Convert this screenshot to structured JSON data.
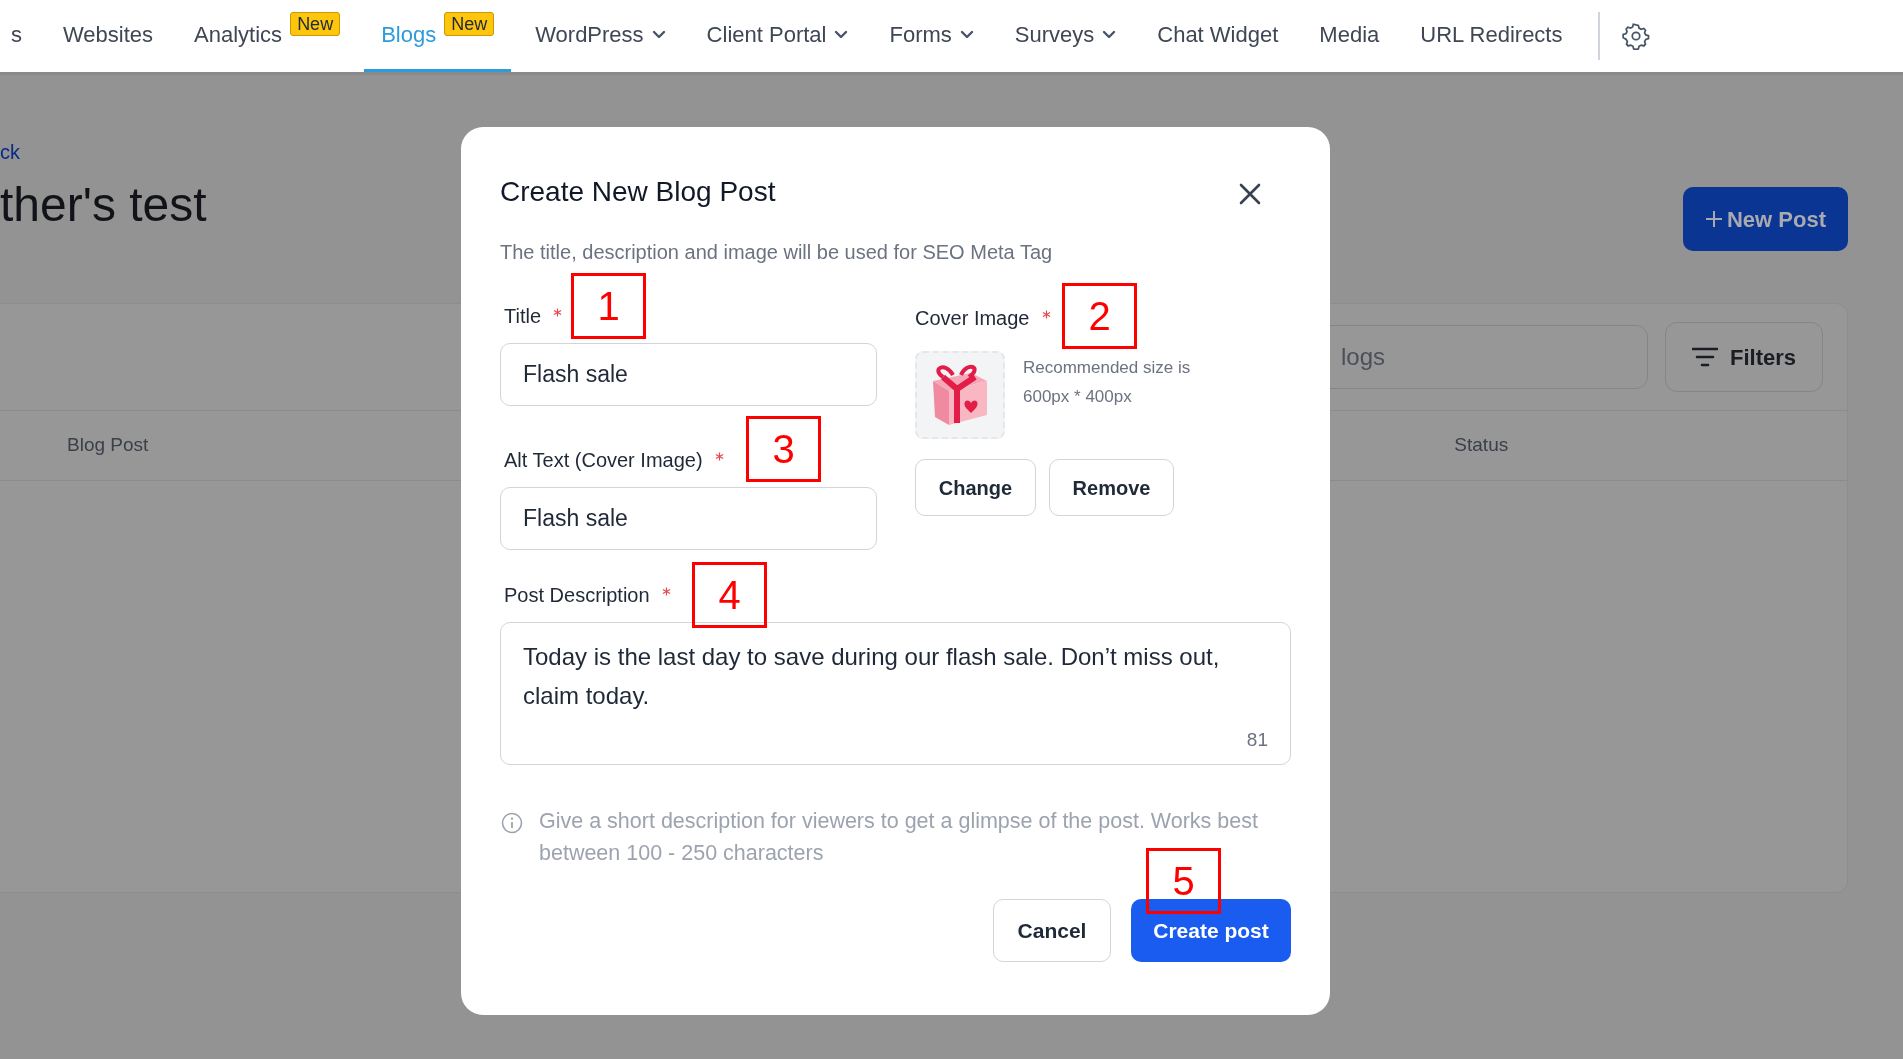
{
  "nav": {
    "items": [
      {
        "label": "s",
        "selected": false,
        "dropdown": false
      },
      {
        "label": "Websites",
        "selected": false,
        "dropdown": false
      },
      {
        "label": "Analytics",
        "selected": false,
        "dropdown": false,
        "badge": "New"
      },
      {
        "label": "Blogs",
        "selected": true,
        "dropdown": false,
        "badge": "New"
      },
      {
        "label": "WordPress",
        "selected": false,
        "dropdown": true
      },
      {
        "label": "Client Portal",
        "selected": false,
        "dropdown": true
      },
      {
        "label": "Forms",
        "selected": false,
        "dropdown": true
      },
      {
        "label": "Surveys",
        "selected": false,
        "dropdown": true
      },
      {
        "label": "Chat Widget",
        "selected": false,
        "dropdown": false
      },
      {
        "label": "Media",
        "selected": false,
        "dropdown": false
      },
      {
        "label": "URL Redirects",
        "selected": false,
        "dropdown": false
      }
    ]
  },
  "page": {
    "back_link": "ck",
    "heading": "ther's test",
    "new_post_button": "New Post",
    "search": {
      "placeholder": "logs"
    },
    "filters_button": "Filters",
    "table": {
      "columns": [
        "Blog Post",
        "Status"
      ]
    }
  },
  "modal": {
    "title": "Create New Blog Post",
    "subtitle": "The title, description and image will be used for SEO Meta Tag",
    "title_field": {
      "label": "Title",
      "required": true,
      "value": "Flash sale"
    },
    "alt_field": {
      "label": "Alt Text (Cover Image)",
      "required": true,
      "value": "Flash sale"
    },
    "cover_image": {
      "label": "Cover Image",
      "required": true,
      "hint": "Recommended size is 600px * 400px",
      "change_button": "Change",
      "remove_button": "Remove"
    },
    "description": {
      "label": "Post Description",
      "required": true,
      "value": "Today is the last day to save during our flash sale. Don’t miss out, claim today.",
      "counter": "81"
    },
    "help": "Give a short description for viewers to get a glimpse of the post. Works best between 100 - 250 characters",
    "cancel_button": "Cancel",
    "create_button": "Create post"
  },
  "annotations": [
    "1",
    "2",
    "3",
    "4",
    "5"
  ]
}
